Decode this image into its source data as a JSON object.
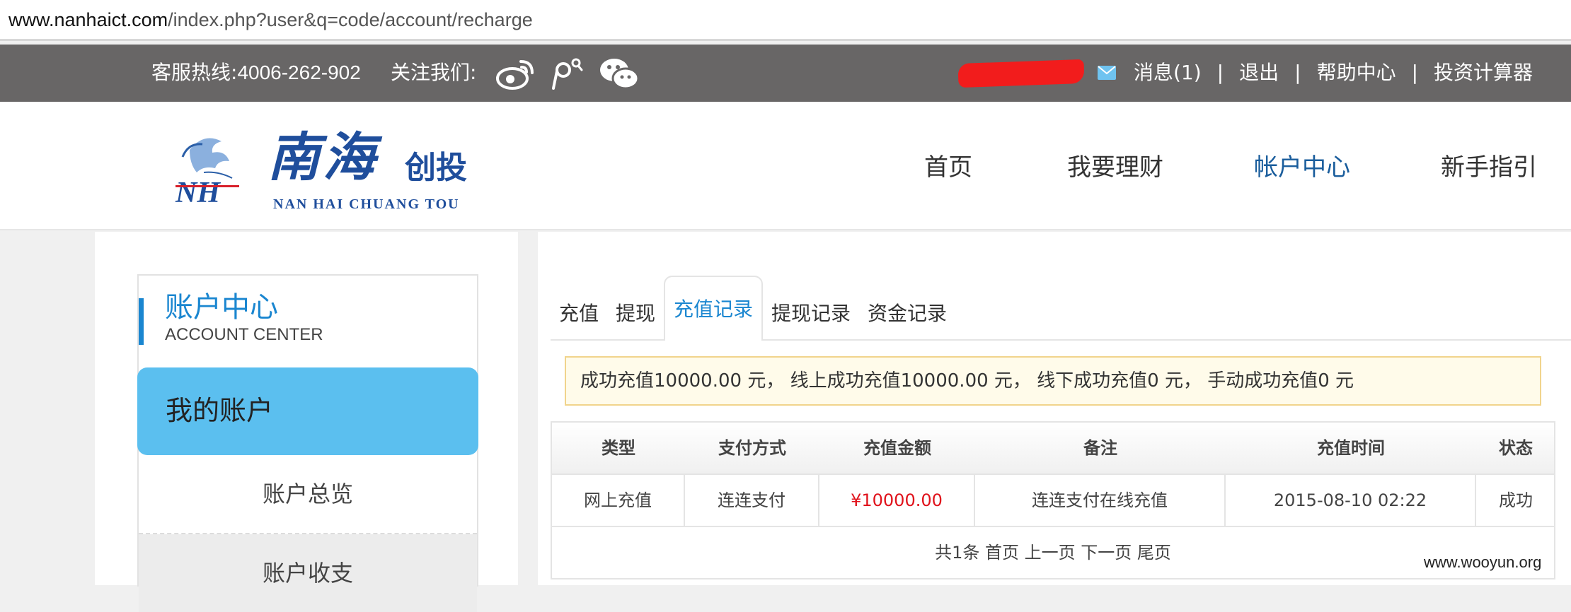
{
  "browser": {
    "url_host": "www.nanhaict.com",
    "url_path": "/index.php?user&q=code/account/recharge"
  },
  "topbar": {
    "hotline_label": "客服热线:",
    "hotline_number": "4006-262-902",
    "follow_label": "关注我们:",
    "social_icons": [
      "weibo-icon",
      "tencent-weibo-icon",
      "wechat-icon"
    ],
    "messages": "消息(1)",
    "logout": "退出",
    "help": "帮助中心",
    "calculator": "投资计算器",
    "separator": "|",
    "redaction_color": "#f21c1c"
  },
  "header": {
    "logo_cn": "南海",
    "logo_cn2": "创投",
    "logo_en": "NAN HAI CHUANG TOU",
    "nav": [
      "首页",
      "我要理财",
      "帐户中心",
      "新手指引"
    ],
    "nav_active_index": 2
  },
  "sidebar": {
    "title": "账户中心",
    "subtitle": "ACCOUNT CENTER",
    "section": "我的账户",
    "items": [
      "账户总览",
      "账户收支"
    ]
  },
  "main": {
    "tabs": [
      "充值",
      "提现",
      "充值记录",
      "提现记录",
      "资金记录"
    ],
    "active_tab_index": 2,
    "summary": "成功充值10000.00 元， 线上成功充值10000.00 元， 线下成功充值0 元， 手动成功充值0 元",
    "table": {
      "headers": [
        "类型",
        "支付方式",
        "充值金额",
        "备注",
        "充值时间",
        "状态"
      ],
      "rows": [
        [
          "网上充值",
          "连连支付",
          "¥10000.00",
          "连连支付在线充值",
          "2015-08-10 02:22",
          "成功"
        ]
      ],
      "pager": "共1条 首页 上一页 下一页 尾页"
    }
  },
  "watermark": "www.wooyun.org",
  "colors": {
    "topbar_bg": "#686666",
    "accent_blue": "#1a86d0",
    "nav_active": "#1a5d9c",
    "sidebar_active_bg": "#5bbfef",
    "amount_red": "#e0121b",
    "summary_bg": "#fffbea",
    "summary_border": "#f1d48c"
  }
}
